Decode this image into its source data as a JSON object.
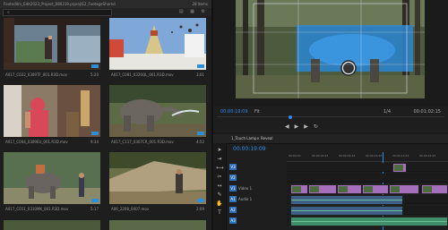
{
  "project": {
    "path": "Footed4m_Edit2023_Project_080319.prproj\\E2_FootageShared",
    "count": "28 Items",
    "clips": [
      {
        "name": "A017_C022_0309TF_001.R3D.mov",
        "dur": "5:20"
      },
      {
        "name": "A017_C081_0326QL_001.R3D.mov",
        "dur": "3:01"
      },
      {
        "name": "A017_C004_0309EU_001.R3D.mov",
        "dur": "9:34"
      },
      {
        "name": "A017_C117_0307CR_001.R3D.mov",
        "dur": "4:52"
      },
      {
        "name": "A017_C011_0310MK_001.R3D.mov",
        "dur": "5:17"
      },
      {
        "name": "A06_2208_0407.mov",
        "dur": "2:09"
      }
    ]
  },
  "program": {
    "timecode": "00:00:19:09",
    "fit": "Fit",
    "fraction": "1/4",
    "duration": "00:01:02:15"
  },
  "timeline": {
    "tab": "1_Touch Lamp× Reveal",
    "timecode": "00:00:19:09",
    "ticks": [
      "00:00:00",
      "00:00:04:23",
      "00:00:09:23",
      "00:00:14:23",
      "00:00:19:23",
      "00:00:24:23"
    ],
    "tracks": [
      {
        "lock": "V3",
        "name": ""
      },
      {
        "lock": "V2",
        "name": ""
      },
      {
        "lock": "V1",
        "name": "Video 1"
      },
      {
        "lock": "A1",
        "name": "Audio 1"
      },
      {
        "lock": "A2",
        "name": ""
      },
      {
        "lock": "A3",
        "name": ""
      }
    ]
  },
  "colors": {
    "accent": "#2d8ceb",
    "video_clip": "#a66fbb",
    "audio_clip": "#3f8f6a"
  }
}
